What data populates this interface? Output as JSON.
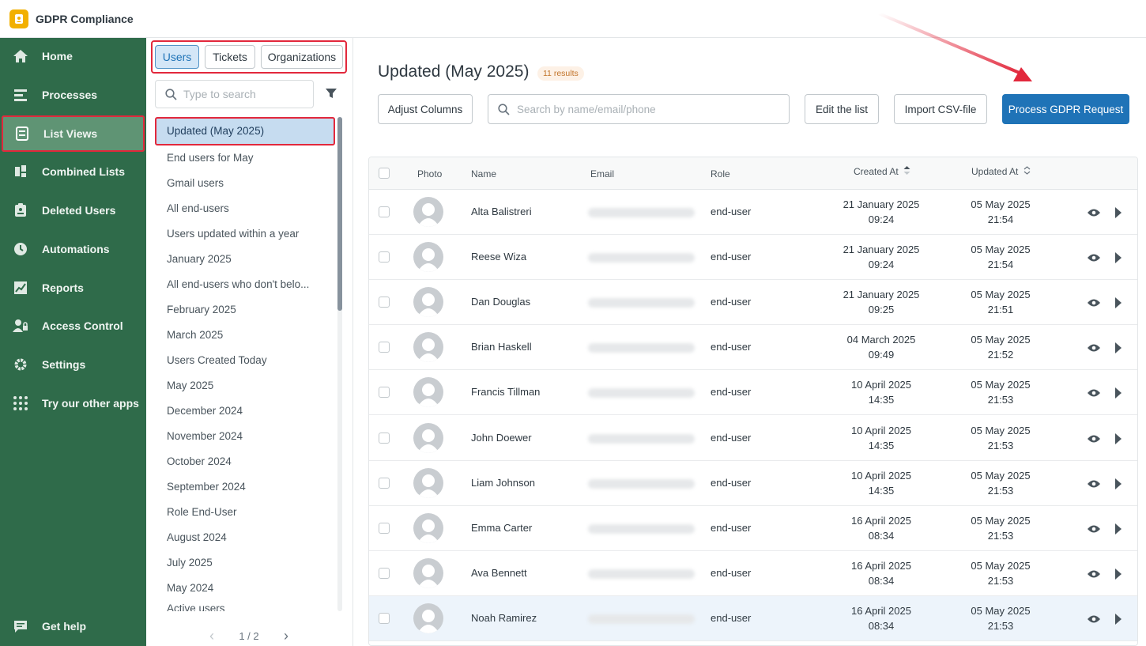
{
  "app": {
    "title": "GDPR Compliance",
    "logo_icon": "lock-shield-icon",
    "accent": "#f2b000"
  },
  "sidebar": {
    "bg": "#2f6b4a",
    "items": [
      {
        "label": "Home",
        "icon": "home-icon"
      },
      {
        "label": "Processes",
        "icon": "processes-icon"
      },
      {
        "label": "List Views",
        "icon": "list-views-icon",
        "active": true
      },
      {
        "label": "Combined Lists",
        "icon": "combined-lists-icon"
      },
      {
        "label": "Deleted Users",
        "icon": "deleted-users-icon"
      },
      {
        "label": "Automations",
        "icon": "clock-icon"
      },
      {
        "label": "Reports",
        "icon": "chart-icon"
      },
      {
        "label": "Access Control",
        "icon": "user-lock-icon"
      },
      {
        "label": "Settings",
        "icon": "gear-icon"
      },
      {
        "label": "Try our other apps",
        "icon": "grid-dots-icon"
      }
    ],
    "help": {
      "label": "Get help",
      "icon": "chat-icon"
    }
  },
  "listpanel": {
    "tabs": [
      {
        "label": "Users",
        "active": true
      },
      {
        "label": "Tickets"
      },
      {
        "label": "Organizations"
      }
    ],
    "search_placeholder": "Type to search",
    "views": [
      "Updated (May 2025)",
      "End users for May",
      "Gmail users",
      "All end-users",
      "Users updated within a year",
      "January 2025",
      "All end-users who don't belo...",
      "February 2025",
      "March 2025",
      "Users Created Today",
      "May 2025",
      "December 2024",
      "November 2024",
      "October 2024",
      "September 2024",
      "Role End-User",
      "August 2024",
      "July 2025",
      "May 2024",
      "Active users"
    ],
    "pager": {
      "text": "1 / 2",
      "prev": "‹",
      "next": "›"
    }
  },
  "main": {
    "title": "Updated (May 2025)",
    "results_badge": "11 results",
    "buttons": {
      "adjust": "Adjust Columns",
      "edit": "Edit the list",
      "import": "Import CSV-file",
      "process": "Process GDPR Request"
    },
    "search_placeholder": "Search by name/email/phone",
    "columns": {
      "photo": "Photo",
      "name": "Name",
      "email": "Email",
      "role": "Role",
      "created": "Created At",
      "updated": "Updated At"
    },
    "rows": [
      {
        "name": "Alta Balistreri",
        "role": "end-user",
        "created_date": "21 January 2025",
        "created_time": "09:24",
        "updated_date": "05 May 2025",
        "updated_time": "21:54"
      },
      {
        "name": "Reese Wiza",
        "role": "end-user",
        "created_date": "21 January 2025",
        "created_time": "09:24",
        "updated_date": "05 May 2025",
        "updated_time": "21:54"
      },
      {
        "name": "Dan Douglas",
        "role": "end-user",
        "created_date": "21 January 2025",
        "created_time": "09:25",
        "updated_date": "05 May 2025",
        "updated_time": "21:51"
      },
      {
        "name": "Brian Haskell",
        "role": "end-user",
        "created_date": "04 March 2025",
        "created_time": "09:49",
        "updated_date": "05 May 2025",
        "updated_time": "21:52"
      },
      {
        "name": "Francis Tillman",
        "role": "end-user",
        "created_date": "10 April 2025",
        "created_time": "14:35",
        "updated_date": "05 May 2025",
        "updated_time": "21:53"
      },
      {
        "name": "John Doewer",
        "role": "end-user",
        "created_date": "10 April 2025",
        "created_time": "14:35",
        "updated_date": "05 May 2025",
        "updated_time": "21:53"
      },
      {
        "name": "Liam Johnson",
        "role": "end-user",
        "created_date": "10 April 2025",
        "created_time": "14:35",
        "updated_date": "05 May 2025",
        "updated_time": "21:53"
      },
      {
        "name": "Emma Carter",
        "role": "end-user",
        "created_date": "16 April 2025",
        "created_time": "08:34",
        "updated_date": "05 May 2025",
        "updated_time": "21:53"
      },
      {
        "name": "Ava Bennett",
        "role": "end-user",
        "created_date": "16 April 2025",
        "created_time": "08:34",
        "updated_date": "05 May 2025",
        "updated_time": "21:53"
      },
      {
        "name": "Noah Ramirez",
        "role": "end-user",
        "created_date": "16 April 2025",
        "created_time": "08:34",
        "updated_date": "05 May 2025",
        "updated_time": "21:53"
      }
    ]
  }
}
